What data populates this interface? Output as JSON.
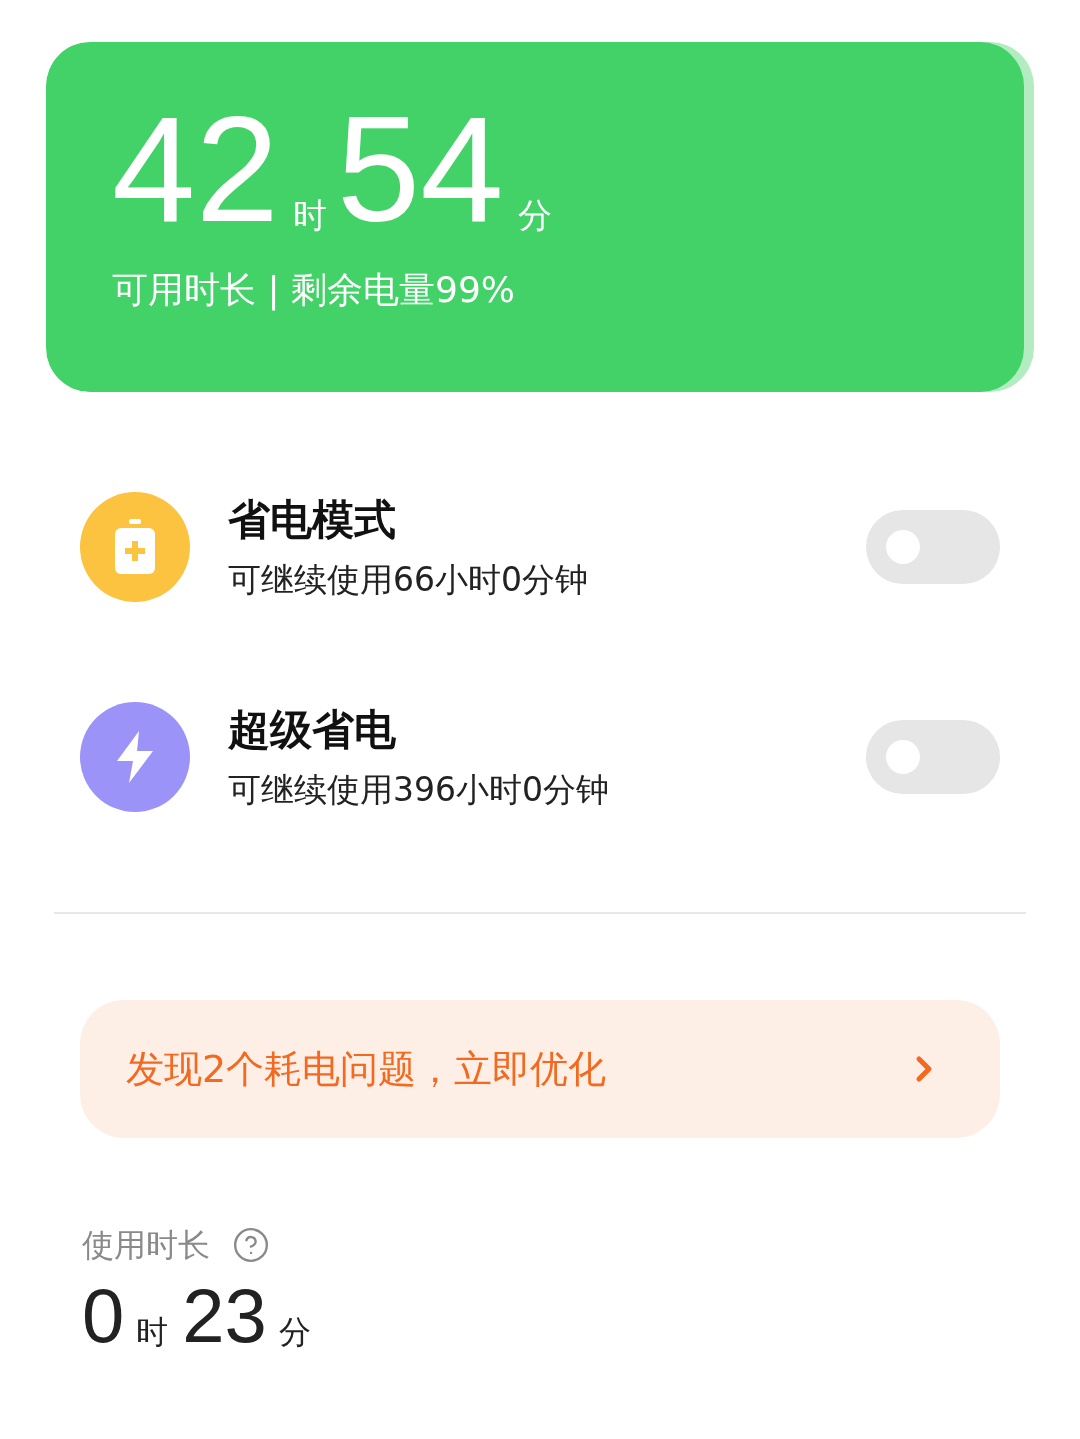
{
  "battery": {
    "hours": "42",
    "hours_unit": "时",
    "minutes": "54",
    "minutes_unit": "分",
    "caption": "可用时长 | 剩余电量99%",
    "level": 0.99
  },
  "modes": [
    {
      "kind": "saver",
      "title": "省电模式",
      "subtitle": "可继续使用66小时0分钟",
      "on": false
    },
    {
      "kind": "super",
      "title": "超级省电",
      "subtitle": "可继续使用396小时0分钟",
      "on": false
    }
  ],
  "issue_banner": {
    "text": "发现2个耗电问题，立即优化"
  },
  "usage": {
    "label": "使用时长",
    "hours": "0",
    "hours_unit": "时",
    "minutes": "23",
    "minutes_unit": "分"
  }
}
